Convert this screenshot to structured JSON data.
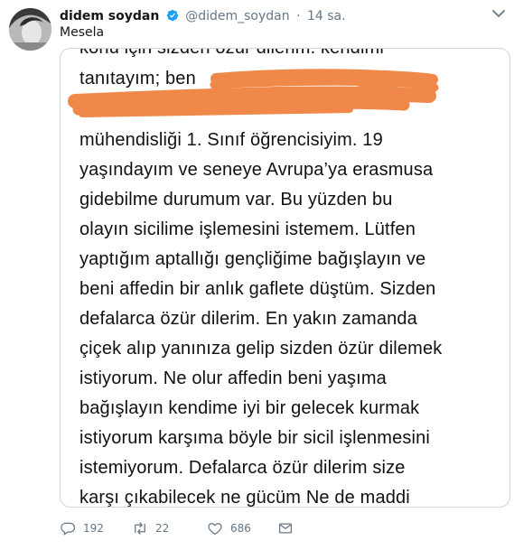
{
  "tweet": {
    "author": {
      "display_name": "didem soydan",
      "handle": "@didem_soydan",
      "verified": true,
      "avatar_icon": "profile-photo"
    },
    "separator": "·",
    "time": "14 sa.",
    "text": "Mesela",
    "media": {
      "lines": [
        "konu için sizden özür dilerim. kendimi",
        "tanıtayım; ben",
        "",
        "mühendisliği 1. Sınıf öğrencisiyim.  19",
        "yaşındayım ve seneye Avrupa’ya erasmusa",
        "gidebilme durumum var.  Bu yüzden bu",
        "olayın sicilime işlemesini istemem. Lütfen",
        "yaptığım aptallığı gençliğime bağışlayın ve",
        "beni affedin bir anlık gaflete düştüm. Sizden",
        "defalarca özür dilerim.  En yakın zamanda",
        "çiçek alıp yanınıza gelip sizden özür dilemek",
        "istiyorum. Ne olur affedin beni yaşıma",
        "bağışlayın kendime iyi bir gelecek kurmak",
        "istiyorum karşıma böyle bir sicil işlenmesini",
        "istemiyorum. Defalarca özür dilerim size",
        "karşı çıkabilecek ne gücüm Ne de maddi"
      ],
      "redaction_color": "#f0884a"
    },
    "actions": {
      "reply": {
        "icon": "reply-icon",
        "count": "192"
      },
      "retweet": {
        "icon": "retweet-icon",
        "count": "22"
      },
      "like": {
        "icon": "heart-icon",
        "count": "686"
      },
      "message": {
        "icon": "envelope-icon"
      }
    },
    "colors": {
      "muted": "#657786",
      "verified_blue": "#1da1f2",
      "border": "#ccd6dd"
    }
  }
}
